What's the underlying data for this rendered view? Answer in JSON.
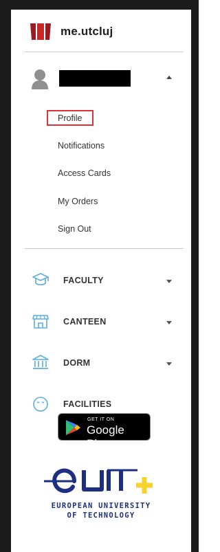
{
  "app": {
    "name": "me.utcluj"
  },
  "user": {
    "name_hidden": true
  },
  "user_menu": {
    "items": [
      {
        "label": "Profile"
      },
      {
        "label": "Notifications"
      },
      {
        "label": "Access Cards"
      },
      {
        "label": "My Orders"
      },
      {
        "label": "Sign Out"
      }
    ],
    "highlighted_item": "Profile"
  },
  "nav": {
    "items": [
      {
        "label": "FACULTY",
        "icon": "graduation-cap-icon",
        "expandable": true
      },
      {
        "label": "CANTEEN",
        "icon": "shop-icon",
        "expandable": true
      },
      {
        "label": "DORM",
        "icon": "building-icon",
        "expandable": true
      },
      {
        "label": "FACILITIES",
        "icon": "smile-icon",
        "expandable": false
      }
    ]
  },
  "store_badge": {
    "small_text": "GET IT ON",
    "big_text": "Google Play"
  },
  "footer": {
    "line1": "EUROPEAN UNIVERSITY",
    "line2": "OF TECHNOLOGY"
  },
  "colors": {
    "icon_blue": "#5aaee0",
    "highlight_red": "#e0313b",
    "eut_blue": "#1e2f82",
    "eut_yellow": "#f5d22c"
  }
}
